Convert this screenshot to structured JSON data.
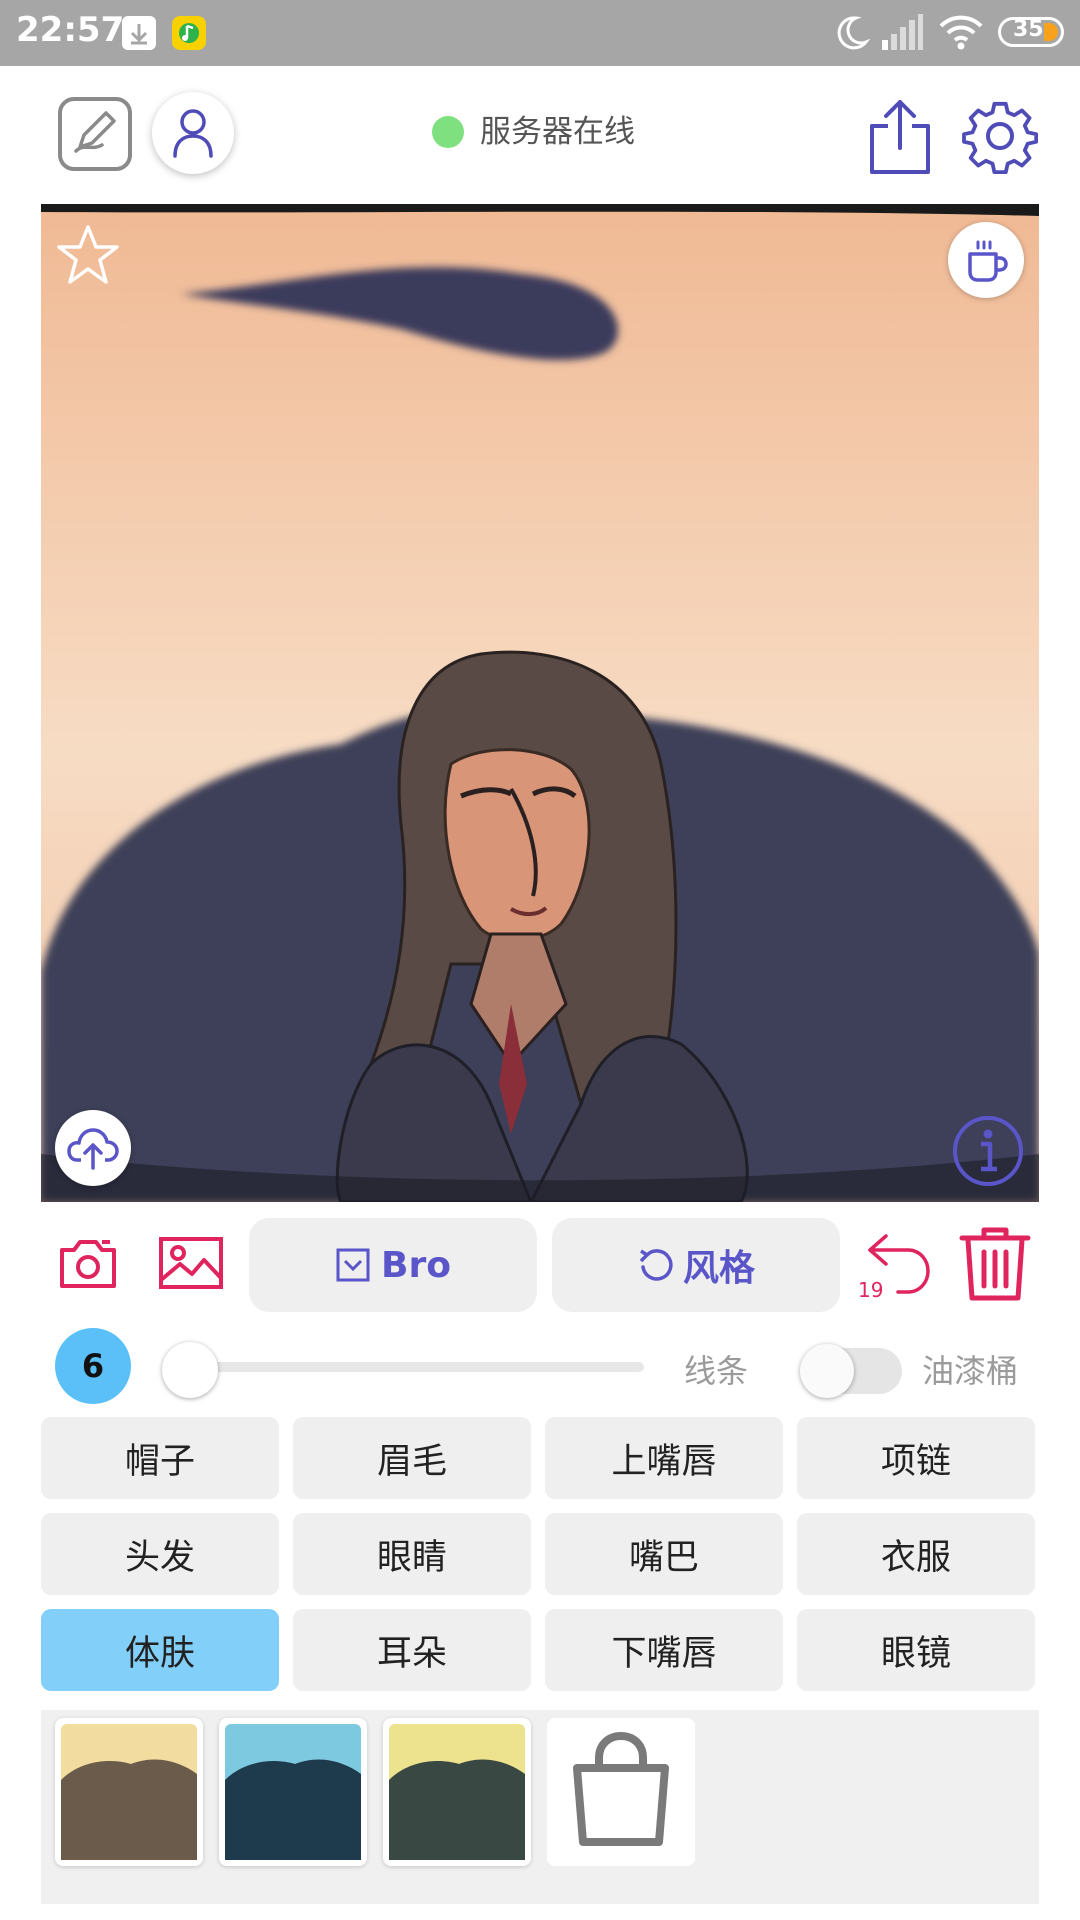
{
  "status_bar": {
    "time": "22:57",
    "battery_level": "35",
    "icons": [
      "download-icon",
      "music-app-icon",
      "moon-icon",
      "signal-icon",
      "wifi-icon",
      "battery-icon"
    ]
  },
  "header": {
    "server_status": "服务器在线",
    "server_status_color": "#7ee07e",
    "icons": [
      "draw-icon",
      "user-icon",
      "share-icon",
      "gear-icon"
    ]
  },
  "canvas": {
    "icons": [
      "star-icon",
      "coffee-cup-icon",
      "cloud-upload-icon",
      "info-icon"
    ]
  },
  "toolbar": {
    "bro_label": "Bro",
    "style_label": "风格",
    "undo_count": "19",
    "accent_color": "#5a55c8",
    "action_color": "#e0245e",
    "icons": [
      "camera-icon",
      "gallery-icon",
      "select-icon",
      "rotate-icon",
      "undo-icon",
      "trash-icon"
    ]
  },
  "brush": {
    "size": "6",
    "line_label": "线条",
    "bucket_label": "油漆桶",
    "slider_level": 0.0,
    "bucket_enabled": false
  },
  "parts": [
    {
      "label": "帽子",
      "active": false
    },
    {
      "label": "眉毛",
      "active": false
    },
    {
      "label": "上嘴唇",
      "active": false
    },
    {
      "label": "项链",
      "active": false
    },
    {
      "label": "头发",
      "active": false
    },
    {
      "label": "眼睛",
      "active": false
    },
    {
      "label": "嘴巴",
      "active": false
    },
    {
      "label": "衣服",
      "active": false
    },
    {
      "label": "体肤",
      "active": true
    },
    {
      "label": "耳朵",
      "active": false
    },
    {
      "label": "下嘴唇",
      "active": false
    },
    {
      "label": "眼镜",
      "active": false
    }
  ],
  "style_tray": {
    "styles": [
      {
        "name": "style-1",
        "bg": "#f2dc9f",
        "fg": "#6b5b4a"
      },
      {
        "name": "style-2",
        "bg": "#7dc9e0",
        "fg": "#1e3b4e"
      },
      {
        "name": "style-3",
        "bg": "#ede28e",
        "fg": "#3a4844"
      }
    ],
    "icons": [
      "shopping-bag-icon"
    ]
  }
}
